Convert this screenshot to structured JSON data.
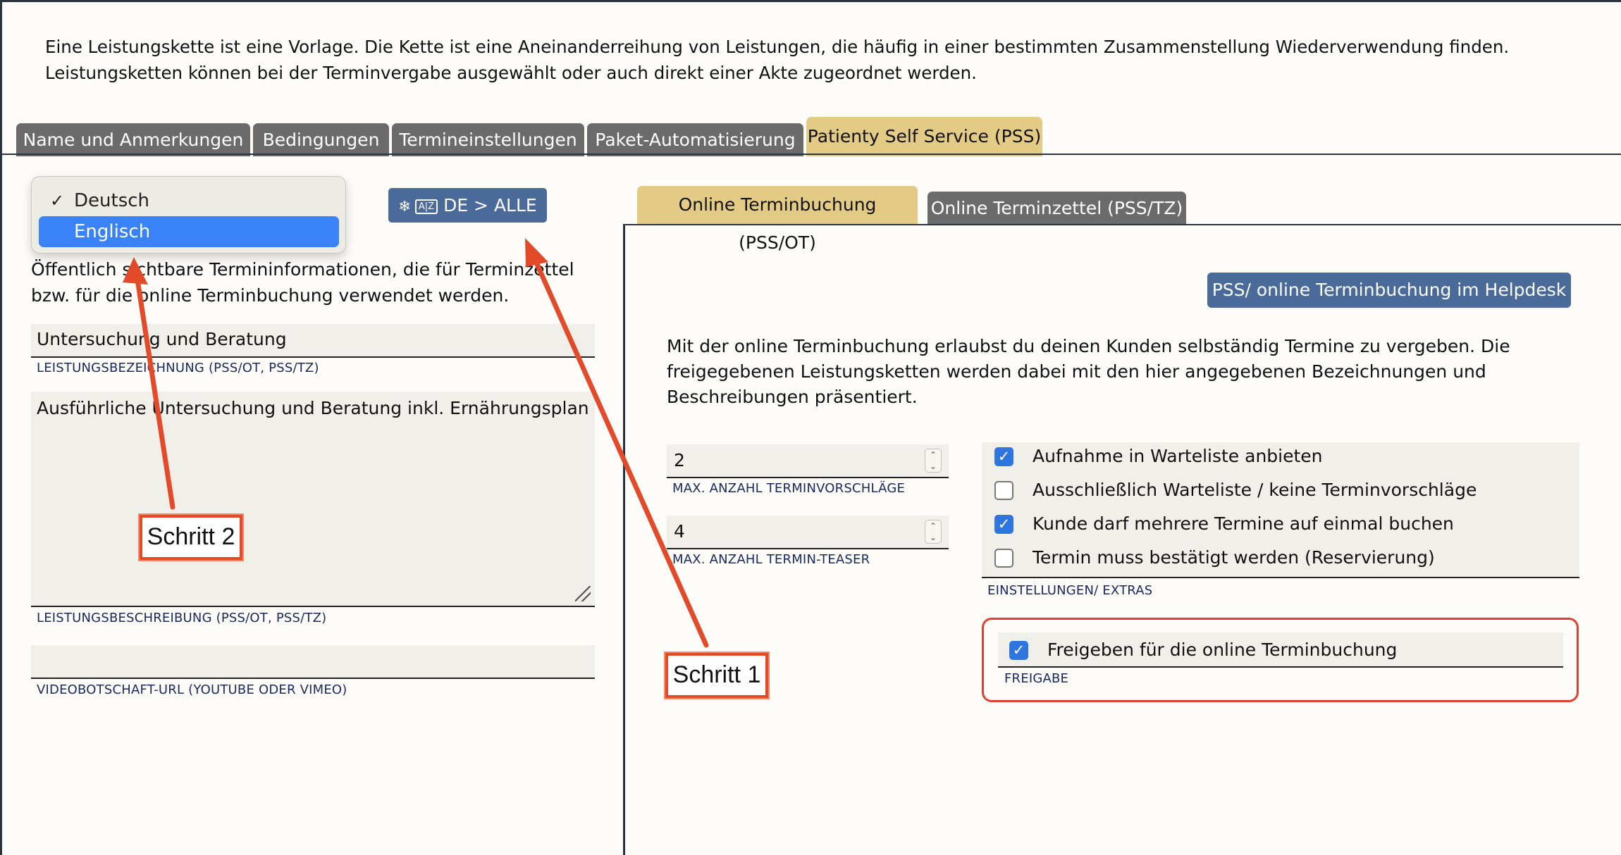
{
  "intro": {
    "text": "Eine Leistungskette ist eine Vorlage. Die Kette ist eine Aneinanderreihung von Leistungen, die häufig in einer bestimmten Zusammenstellung Wiederverwendung finden. Leistungsketten können bei der Terminvergabe ausgewählt oder auch direkt einer Akte zugeordnet werden."
  },
  "tabs": [
    {
      "label": "Name und Anmerkungen"
    },
    {
      "label": "Bedingungen"
    },
    {
      "label": "Termineinstellungen"
    },
    {
      "label": "Paket-Automatisierung"
    },
    {
      "label": "Patienty Self Service (PSS)"
    }
  ],
  "active_tab": "Patienty Self Service (PSS)",
  "language_menu": {
    "options": [
      {
        "label": "Deutsch",
        "checked": true
      },
      {
        "label": "Englisch",
        "highlighted": true
      }
    ]
  },
  "translate_button": {
    "label": "DE > ALLE",
    "icons": [
      "snowflake-icon",
      "translate-az-icon"
    ]
  },
  "left": {
    "description": "Öffentlich sichtbare Termininformationen, die für Terminzettel bzw. für die online Terminbuchung verwendet werden.",
    "service_name": {
      "value": "Untersuchung und Beratung",
      "label": "LEISTUNGSBEZEICHNUNG (PSS/OT, PSS/TZ)"
    },
    "service_description": {
      "value": "Ausführliche Untersuchung und Beratung inkl. Ernährungsplan",
      "label": "LEISTUNGSBESCHREIBUNG (PSS/OT, PSS/TZ)"
    },
    "video_url": {
      "value": "",
      "label": "VIDEOBOTSCHAFT-URL (YOUTUBE ODER VIMEO)"
    }
  },
  "sub_tabs": [
    {
      "label": "Online Terminbuchung (PSS/OT)"
    },
    {
      "label": "Online Terminzettel (PSS/TZ)"
    }
  ],
  "active_sub_tab": "Online Terminbuchung (PSS/OT)",
  "right": {
    "helpdesk_button": "PSS/ online Terminbuchung im Helpdesk",
    "description": "Mit der online Terminbuchung erlaubst du deinen Kunden selbständig Termine zu vergeben. Die freigegebenen Leistungsketten werden dabei mit den hier angegebenen Bezeichnungen und Beschreibungen präsentiert.",
    "max_suggestions": {
      "value": "2",
      "label": "MAX. ANZAHL TERMINVORSCHLÄGE"
    },
    "max_teaser": {
      "value": "4",
      "label": "MAX. ANZAHL TERMIN-TEASER"
    },
    "options": [
      {
        "label": "Aufnahme in Warteliste anbieten",
        "checked": true
      },
      {
        "label": "Ausschließlich Warteliste / keine Terminvorschläge",
        "checked": false
      },
      {
        "label": "Kunde darf mehrere Termine auf einmal buchen",
        "checked": true
      },
      {
        "label": "Termin muss bestätigt werden (Reservierung)",
        "checked": false
      }
    ],
    "options_label": "EINSTELLUNGEN/ EXTRAS",
    "release": {
      "label": "Freigeben für die online Terminbuchung",
      "checked": true,
      "group_label": "FREIGABE"
    }
  },
  "annotations": {
    "step1": "Schritt 1",
    "step2": "Schritt 2",
    "color": "#e34a2a"
  },
  "colors": {
    "active_tab": "#e3cb86",
    "inactive_tab": "#6b6b6b",
    "primary_button": "#4a6a9a",
    "checkbox": "#2f75e0",
    "highlight_border": "#e0402f"
  }
}
